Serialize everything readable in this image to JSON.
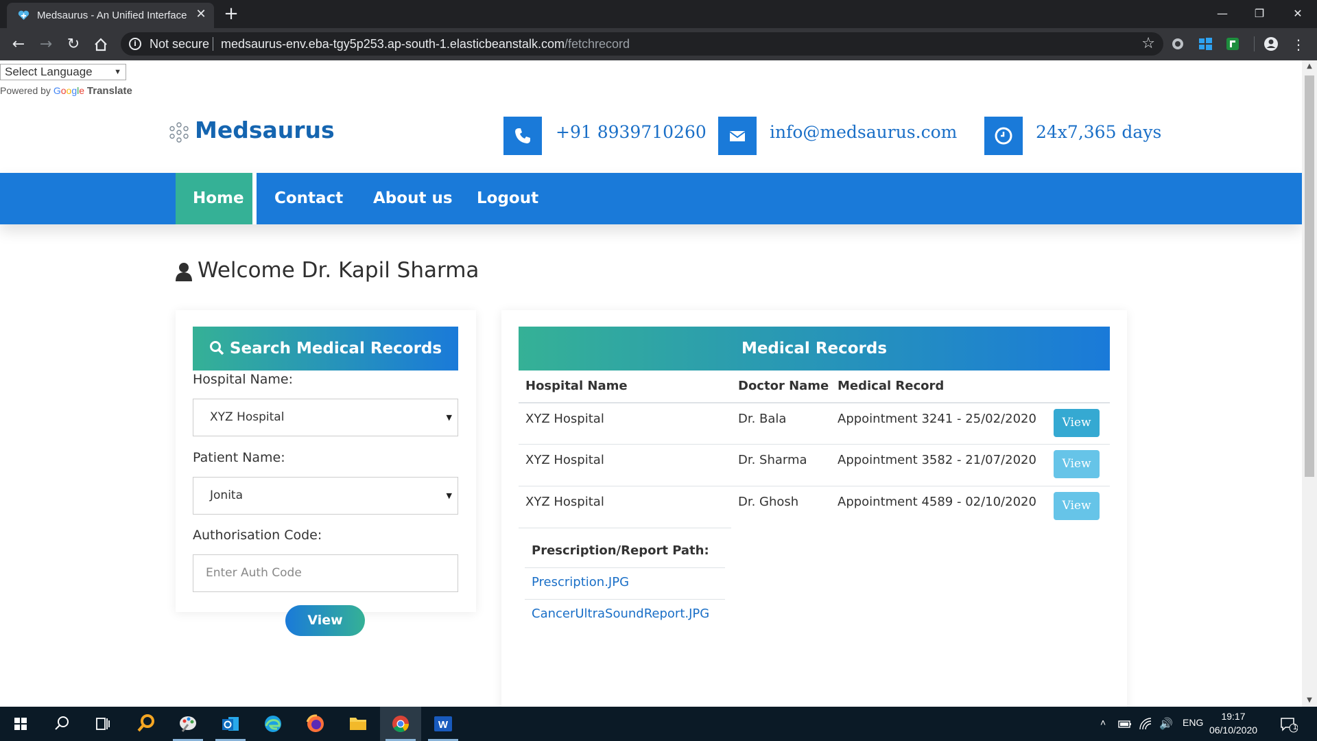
{
  "browser": {
    "tab_title": "Medsaurus - An Unified Interface",
    "tab_close": "✕",
    "new_tab": "+",
    "security": "Not secure",
    "url_host": "medsaurus-env.eba-tgy5p253.ap-south-1.elasticbeanstalk.com",
    "url_path": "/fetchrecord"
  },
  "translate": {
    "select_label": "Select Language",
    "powered_by": "Powered by",
    "google": [
      "G",
      "o",
      "o",
      "g",
      "l",
      "e"
    ],
    "translate": "Translate"
  },
  "header": {
    "logo": "Medsaurus",
    "phone": "+91 8939710260",
    "email": "info@medsaurus.com",
    "hours": "24x7,365 days"
  },
  "nav": {
    "items": [
      "Home",
      "Contact",
      "About us",
      "Logout"
    ],
    "active": "Home"
  },
  "welcome": "Welcome Dr. Kapil Sharma",
  "search": {
    "title": "Search Medical Records",
    "hospital_label": "Hospital Name:",
    "hospital_value": "XYZ Hospital",
    "patient_label": "Patient Name:",
    "patient_value": "Jonita",
    "auth_label": "Authorisation Code:",
    "auth_placeholder": "Enter Auth Code",
    "view_label": "View"
  },
  "records": {
    "title": "Medical Records",
    "columns": [
      "Hospital Name",
      "Doctor Name",
      "Medical Record"
    ],
    "rows": [
      {
        "hospital": "XYZ Hospital",
        "doctor": "Dr. Bala",
        "record": "Appointment 3241 - 25/02/2020",
        "action": "View"
      },
      {
        "hospital": "XYZ Hospital",
        "doctor": "Dr. Sharma",
        "record": "Appointment 3582 - 21/07/2020",
        "action": "View"
      },
      {
        "hospital": "XYZ Hospital",
        "doctor": "Dr. Ghosh",
        "record": "Appointment 4589 - 02/10/2020",
        "action": "View"
      }
    ],
    "prescription_heading": "Prescription/Report Path:",
    "files": [
      "Prescription.JPG",
      "CancerUltraSoundReport.JPG"
    ]
  },
  "taskbar": {
    "language": "ENG",
    "time": "19:17",
    "date": "06/10/2020",
    "notifications": "1"
  },
  "colors": {
    "primary_blue": "#1a7ad9",
    "teal": "#35b196",
    "view_button": "#35a9d2"
  }
}
